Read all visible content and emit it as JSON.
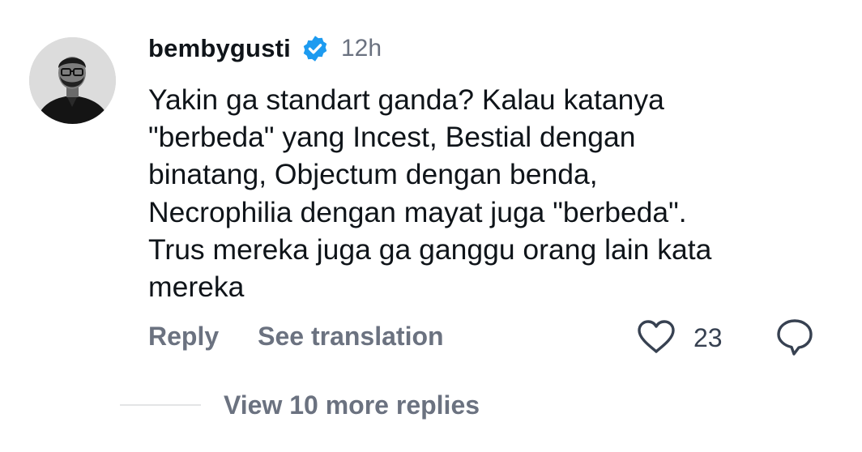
{
  "comment": {
    "username": "bembygusti",
    "verified_icon": "verified-badge-icon",
    "timestamp": "12h",
    "text": "Yakin ga standart ganda? Kalau katanya\n\"berbeda\" yang Incest, Bestial dengan\nbinatang, Objectum dengan benda,\nNecrophilia dengan mayat juga \"berbeda\".\nTrus mereka juga ga ganggu orang lain kata\nmereka",
    "accent_color": "#1d9bf0"
  },
  "actions": {
    "reply_label": "Reply",
    "translate_label": "See translation",
    "like_icon": "heart-outline-icon",
    "like_count": "23",
    "reply_icon": "speech-bubble-icon"
  },
  "replies": {
    "view_more_label": "View 10 more replies"
  }
}
